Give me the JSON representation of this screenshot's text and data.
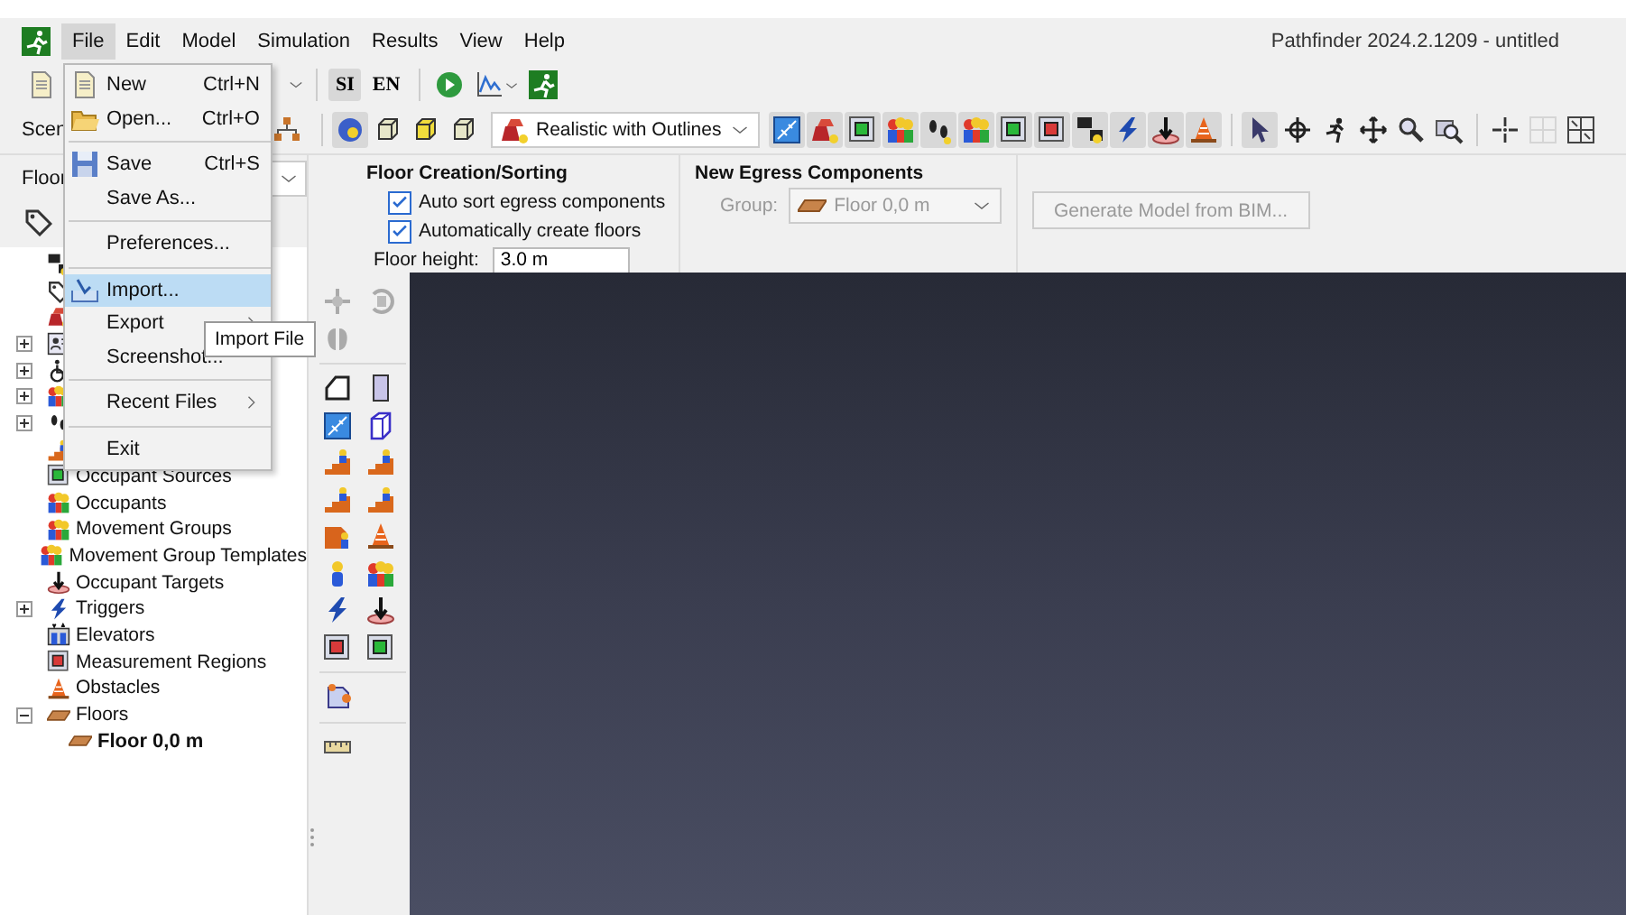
{
  "window": {
    "title": "Pathfinder 2024.2.1209 - untitled"
  },
  "menubar": [
    {
      "label": "File",
      "selected": true
    },
    {
      "label": "Edit",
      "selected": false
    },
    {
      "label": "Model",
      "selected": false
    },
    {
      "label": "Simulation",
      "selected": false
    },
    {
      "label": "Results",
      "selected": false
    },
    {
      "label": "View",
      "selected": false
    },
    {
      "label": "Help",
      "selected": false
    }
  ],
  "toolbar": {
    "units": [
      {
        "label": "SI",
        "selected": true
      },
      {
        "label": "EN",
        "selected": false
      }
    ],
    "view_buttons": [
      {
        "selected": true
      },
      {
        "selected": false
      },
      {
        "selected": false
      },
      {
        "selected": false
      }
    ],
    "render_mode": "Realistic with Outlines",
    "egress_tools": [
      {
        "pressed": true
      },
      {
        "pressed": true
      },
      {
        "pressed": true
      },
      {
        "pressed": true
      },
      {
        "pressed": true
      },
      {
        "pressed": true
      },
      {
        "pressed": true
      },
      {
        "pressed": true
      },
      {
        "pressed": true
      },
      {
        "pressed": true
      },
      {
        "pressed": true
      },
      {
        "pressed": true
      }
    ],
    "modes": [
      {
        "selected": true
      },
      {
        "selected": false
      },
      {
        "selected": false
      },
      {
        "selected": false
      },
      {
        "selected": false
      },
      {
        "selected": false
      }
    ],
    "snap_tools": [
      {
        "disabled": false
      },
      {
        "disabled": true
      },
      {
        "disabled": false
      }
    ]
  },
  "left_panel": {
    "scenario_label": "Scen",
    "floor_label": "Floor",
    "tree": [
      {
        "kind": "leaf"
      },
      {
        "kind": "leaf"
      },
      {
        "kind": "leaf"
      },
      {
        "kind": "group",
        "expanded": false
      },
      {
        "kind": "group",
        "expanded": false
      },
      {
        "kind": "group",
        "expanded": false
      },
      {
        "kind": "group",
        "expanded": false
      },
      {
        "kind": "leaf"
      },
      {
        "label": "Occupant Sources",
        "kind": "leaf"
      },
      {
        "label": "Occupants",
        "kind": "leaf"
      },
      {
        "label": "Movement Groups",
        "kind": "leaf"
      },
      {
        "label": "Movement Group Templates",
        "kind": "leaf"
      },
      {
        "label": "Occupant Targets",
        "kind": "leaf"
      },
      {
        "label": "Triggers",
        "kind": "group",
        "expanded": false
      },
      {
        "label": "Elevators",
        "kind": "leaf"
      },
      {
        "label": "Measurement Regions",
        "kind": "leaf"
      },
      {
        "label": "Obstacles",
        "kind": "leaf"
      },
      {
        "label": "Floors",
        "kind": "group",
        "expanded": true,
        "children": [
          {
            "label": "Floor 0,0 m"
          }
        ]
      }
    ]
  },
  "properties": {
    "floor_section": {
      "title": "Floor Creation/Sorting",
      "options": [
        {
          "label": "Auto sort egress components",
          "checked": true
        },
        {
          "label": "Automatically create floors",
          "checked": true
        }
      ],
      "height_label": "Floor height:",
      "height_value": "3.0 m"
    },
    "egress_section": {
      "title": "New Egress Components",
      "group_label": "Group:",
      "group_value": "Floor 0,0 m",
      "disabled": true
    },
    "generate_button": {
      "label": "Generate Model from BIM...",
      "disabled": true
    }
  },
  "file_menu": [
    {
      "kind": "item",
      "label": "New",
      "shortcut": "Ctrl+N",
      "submenu": false,
      "selected": false
    },
    {
      "kind": "item",
      "label": "Open...",
      "shortcut": "Ctrl+O",
      "submenu": false,
      "selected": false
    },
    {
      "kind": "separator"
    },
    {
      "kind": "item",
      "label": "Save",
      "shortcut": "Ctrl+S",
      "submenu": false,
      "selected": false
    },
    {
      "kind": "item",
      "label": "Save As...",
      "submenu": false,
      "selected": false
    },
    {
      "kind": "separator"
    },
    {
      "kind": "item",
      "label": "Preferences...",
      "submenu": false,
      "selected": false
    },
    {
      "kind": "separator"
    },
    {
      "kind": "item",
      "label": "Import...",
      "submenu": false,
      "selected": true
    },
    {
      "kind": "item",
      "label": "Export",
      "submenu": true,
      "selected": false
    },
    {
      "kind": "item",
      "label": "Screenshot...",
      "submenu": false,
      "selected": false
    },
    {
      "kind": "separator"
    },
    {
      "kind": "item",
      "label": "Recent Files",
      "submenu": true,
      "selected": false
    },
    {
      "kind": "separator"
    },
    {
      "kind": "item",
      "label": "Exit",
      "submenu": false,
      "selected": false
    }
  ],
  "tooltip": {
    "text": "Import File"
  }
}
